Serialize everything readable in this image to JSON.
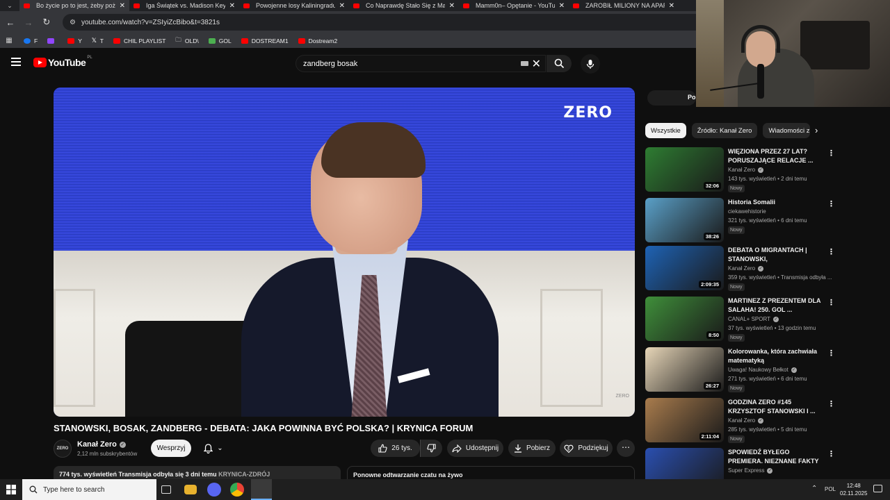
{
  "browser": {
    "tabs": [
      {
        "title": "Bo życie po to jest, żeby pożyczć",
        "active": true
      },
      {
        "title": "Iga Świątek vs. Madison Keys |",
        "active": false
      },
      {
        "title": "Powojenne losy Kaliningradu. P",
        "active": false
      },
      {
        "title": "Co Naprawdę Stało Się z Made",
        "active": false
      },
      {
        "title": "Mamm0n– Opętanie - YouTube",
        "active": false
      },
      {
        "title": "ZAROBIŁ MILIONY NA APARTA",
        "active": false
      }
    ],
    "url": "youtube.com/watch?v=ZSIyiZcBibo&t=3821s",
    "bookmarks": [
      {
        "label": "F",
        "color": "#1877f2"
      },
      {
        "label": "",
        "color": "#9146ff"
      },
      {
        "label": "Y",
        "color": "#ff0000"
      },
      {
        "label": "T",
        "color": "#ffffff"
      },
      {
        "label": "CHIL PLAYLIST",
        "color": "#ff0000"
      },
      {
        "label": "OLD\\",
        "color": "#cccccc"
      },
      {
        "label": "GOL",
        "color": "#4caf50"
      },
      {
        "label": "DOSTREAM1",
        "color": "#ff0000"
      },
      {
        "label": "Dostream2",
        "color": "#ff0000"
      }
    ]
  },
  "youtube": {
    "logo_text": "YouTube",
    "country_code": "PL",
    "search_query": "zandberg bosak"
  },
  "video": {
    "overlay_logo": "ZERO",
    "corner_mark": "ZERO",
    "title": "STANOWSKI, BOSAK, ZANDBERG - DEBATA: JAKA POWINNA BYĆ POLSKA? | KRYNICA FORUM",
    "channel_avatar_text": "ZERO",
    "channel": "Kanał Zero",
    "subscribers": "2,12 mln subskrybentów",
    "support_label": "Wesprzyj",
    "likes": "26 tys.",
    "share_label": "Udostępnij",
    "download_label": "Pobierz",
    "thanks_label": "Podziękuj",
    "views_meta": "774 tys. wyświetleń  Transmisja odbyła się 3 dni temu",
    "location_tag": "KRYNICA-ZDRÓJ",
    "chat_replay": "Ponowne odtwarzanie czatu na żywo"
  },
  "sidebar": {
    "chat_pill": "Po",
    "chips": [
      "Wszystkie",
      "Źródło: Kanał Zero",
      "Wiadomości z"
    ],
    "recommendations": [
      {
        "title": "WIĘZIONA PRZEZ 27 LAT? PORUSZAJĄCE RELACJE ...",
        "channel": "Kanał Zero",
        "verified": true,
        "views": "143 tys. wyświetleń • 2 dni temu",
        "badge": "Nowy",
        "duration": "32:06",
        "color": "#2e7d32"
      },
      {
        "title": "Historia Somalii",
        "channel": "ciekawehistorie",
        "verified": false,
        "views": "321 tys. wyświetleń • 6 dni temu",
        "badge": "Nowy",
        "duration": "38:26",
        "color": "#5aa0c8"
      },
      {
        "title": "DEBATA O MIGRANTACH | STANOWSKI, ZAJĄCZKOWSK...",
        "channel": "Kanał Zero",
        "verified": true,
        "views": "359 tys. wyświetleń • Transmisja odbyła ...",
        "badge": "Nowy",
        "duration": "2:09:35",
        "color": "#1e63b5"
      },
      {
        "title": "MARTINEZ Z PREZENTEM DLA SALAHA! 250. GOL ...",
        "channel": "CANAL+ SPORT",
        "verified": true,
        "views": "37 tys. wyświetleń • 13 godzin temu",
        "badge": "Nowy",
        "duration": "8:50",
        "color": "#3f8f3a"
      },
      {
        "title": "Kolorowanka, która zachwiała matematyką",
        "channel": "Uwaga! Naukowy Bełkot",
        "verified": true,
        "views": "271 tys. wyświetleń • 6 dni temu",
        "badge": "Nowy",
        "duration": "26:27",
        "color": "#e7d6b8"
      },
      {
        "title": "GODZINA ZERO #145 KRZYSZTOF STANOWSKI I ...",
        "channel": "Kanał Zero",
        "verified": true,
        "views": "285 tys. wyświetleń • 5 dni temu",
        "badge": "Nowy",
        "duration": "2:11:04",
        "color": "#a97c4d"
      },
      {
        "title": "SPOWIEDŹ BYŁEGO PREMIERA. NIEZNANE FAKTY Z ŻYCIA ...",
        "channel": "Super Express",
        "verified": true,
        "views": "",
        "badge": "",
        "duration": "",
        "color": "#2a4fb0"
      }
    ]
  },
  "taskbar": {
    "search_placeholder": "Type here to search",
    "language": "POL",
    "time": "12:48",
    "date": "02.11.2025"
  }
}
